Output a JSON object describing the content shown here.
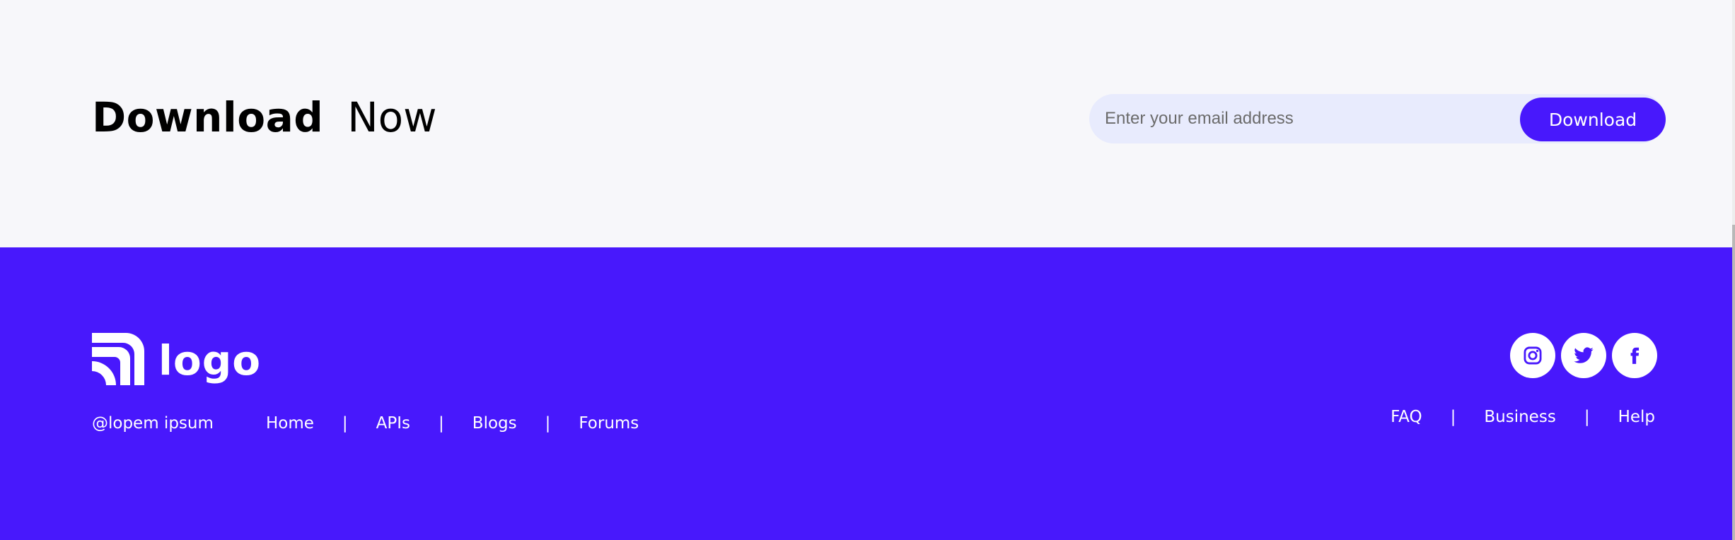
{
  "cta": {
    "title_bold": "Download",
    "title_light": "Now",
    "email_placeholder": "Enter your email address",
    "button_label": "Download"
  },
  "footer": {
    "logo_text": "logo",
    "copyright": "@lopem ipsum",
    "nav_left": [
      "Home",
      "APIs",
      "Blogs",
      "Forums"
    ],
    "nav_right": [
      "FAQ",
      "Business",
      "Help"
    ],
    "separator": "|",
    "social_icons": [
      "instagram-icon",
      "twitter-icon",
      "facebook-icon"
    ]
  },
  "colors": {
    "brand": "#4818fc",
    "page_background": "#f7f7fa",
    "input_background": "#e8ebfd",
    "footer_text": "#ffffff"
  }
}
